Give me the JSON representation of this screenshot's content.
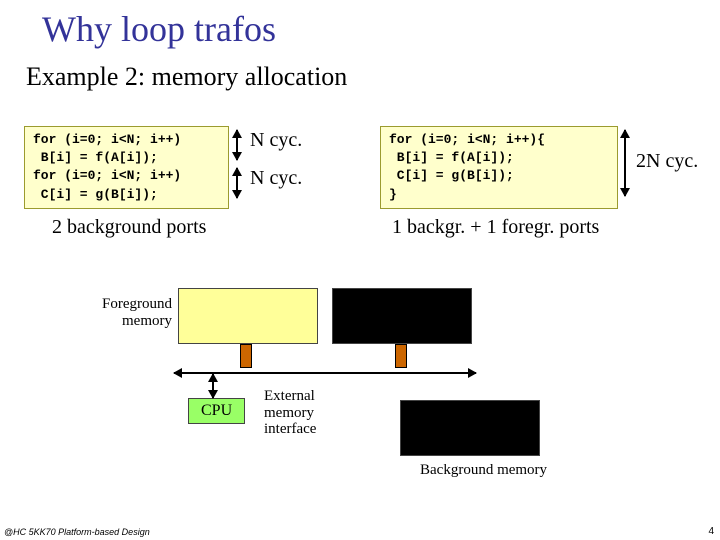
{
  "title": "Why loop trafos",
  "subtitle": "Example 2: memory allocation",
  "code_left": "for (i=0; i<N; i++)\n B[i] = f(A[i]);\nfor (i=0; i<N; i++)\n C[i] = g(B[i]);",
  "code_right": "for (i=0; i<N; i++){\n B[i] = f(A[i]);\n C[i] = g(B[i]);\n}",
  "ncyc1": "N cyc.",
  "ncyc2": "N cyc.",
  "ncyc3": "2N cyc.",
  "caption_left": "2 background ports",
  "caption_right": "1 backgr. + 1 foregr. ports",
  "diag": {
    "foreground": "Foreground\nmemory",
    "cpu": "CPU",
    "ext_if": "External\nmemory\ninterface",
    "background": "Background memory"
  },
  "footer": "@HC 5KK70 Platform-based Design",
  "pagenum": "4"
}
